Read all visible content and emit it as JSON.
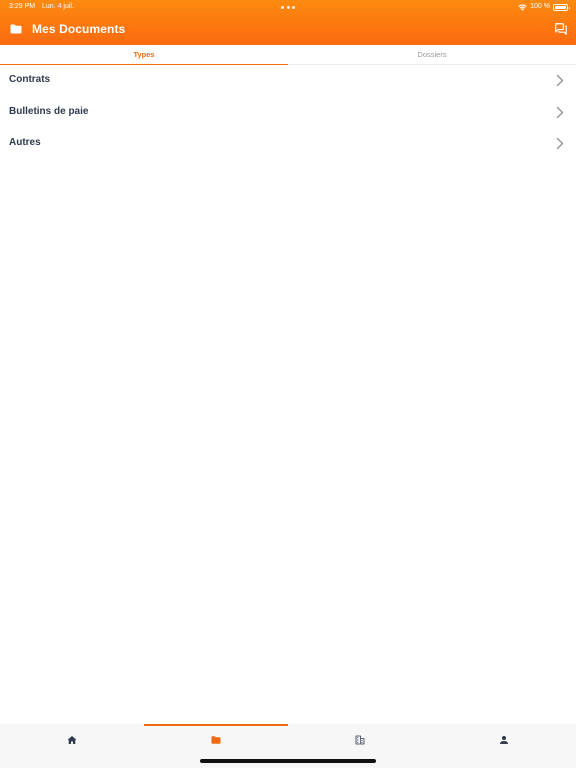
{
  "status_bar": {
    "time": "3:29 PM",
    "date": "Lun. 4 juil.",
    "battery": "100 %"
  },
  "header": {
    "title": "Mes Documents",
    "left_icon": "folder-icon",
    "right_icon": "chat-bubbles-icon"
  },
  "tabs": [
    {
      "label": "Types",
      "active": true
    },
    {
      "label": "Dossiers",
      "active": false
    }
  ],
  "list": {
    "items": [
      {
        "label": "Contrats"
      },
      {
        "label": "Bulletins de paie"
      },
      {
        "label": "Autres"
      }
    ],
    "trailing_icon": "chevron-right-icon"
  },
  "bottom_nav": {
    "items": [
      {
        "icon": "home-icon",
        "active": false
      },
      {
        "icon": "folder-icon",
        "active": true
      },
      {
        "icon": "building-icon",
        "active": false
      },
      {
        "icon": "person-icon",
        "active": false
      }
    ]
  },
  "colors": {
    "header_gradient_top": "#fd8a10",
    "header_gradient_bottom": "#fb6a10",
    "accent": "#f06a14",
    "label_text": "#2e3a4d",
    "inactive_text": "#9a9a9a",
    "nav_icon": "#2e3a4d",
    "nav_background": "#f7f7f7"
  }
}
